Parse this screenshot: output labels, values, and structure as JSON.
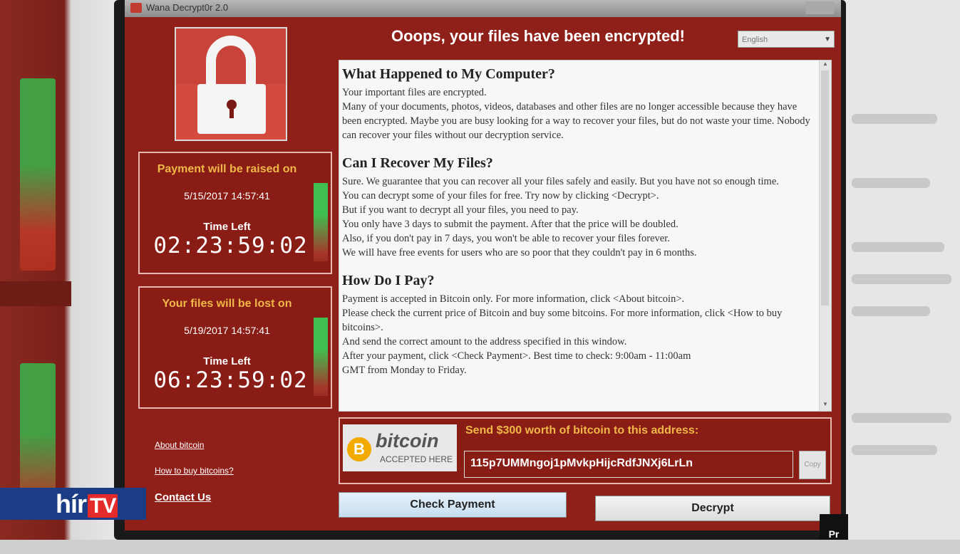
{
  "window": {
    "title": "Wana Decrypt0r 2.0",
    "close_label": "",
    "headline": "Ooops, your files have been encrypted!",
    "language": "English"
  },
  "timers": {
    "raise": {
      "heading": "Payment will be raised on",
      "date": "5/15/2017 14:57:41",
      "time_left_label": "Time Left",
      "countdown": "02:23:59:02"
    },
    "lost": {
      "heading": "Your files will be lost on",
      "date": "5/19/2017 14:57:41",
      "time_left_label": "Time Left",
      "countdown": "06:23:59:02"
    }
  },
  "links": {
    "about_bitcoin": "About bitcoin",
    "how_to_buy": "How to buy bitcoins?",
    "contact_us": "Contact Us"
  },
  "message": {
    "s1_title": "What Happened to My Computer?",
    "s1_p1": "Your important files are encrypted.",
    "s1_p2": "Many of your documents, photos, videos, databases and other files are no longer accessible because they have been encrypted. Maybe you are busy looking for a way to recover your files, but do not waste your time. Nobody can recover your files without our decryption service.",
    "s2_title": "Can I Recover My Files?",
    "s2_p1": "Sure. We guarantee that you can recover all your files safely and easily. But you have not so enough time.",
    "s2_p2": "You can decrypt some of your files for free. Try now by clicking <Decrypt>.",
    "s2_p3": "But if you want to decrypt all your files, you need to pay.",
    "s2_p4": "You only have 3 days to submit the payment. After that the price will be doubled.",
    "s2_p5": "Also, if you don't pay in 7 days, you won't be able to recover your files forever.",
    "s2_p6": "We will have free events for users who are so poor that they couldn't pay in 6 months.",
    "s3_title": "How Do I Pay?",
    "s3_p1": "Payment is accepted in Bitcoin only. For more information, click <About bitcoin>.",
    "s3_p2": "Please check the current price of Bitcoin and buy some bitcoins. For more information, click <How to buy bitcoins>.",
    "s3_p3": "And send the correct amount to the address specified in this window.",
    "s3_p4": "After your payment, click <Check Payment>. Best time to check: 9:00am - 11:00am",
    "s3_p5": "GMT from Monday to Friday."
  },
  "bitcoin": {
    "logo_word": "bitcoin",
    "logo_sub": "ACCEPTED HERE",
    "send_label": "Send $300 worth of bitcoin to this address:",
    "address": "115p7UMMngoj1pMvkpHijcRdfJNXj6LrLn",
    "copy_label": "Copy"
  },
  "buttons": {
    "check_payment": "Check Payment",
    "decrypt": "Decrypt"
  },
  "overlay": {
    "logo_main": "hír",
    "logo_tv": "TV",
    "corner": "Pr"
  }
}
